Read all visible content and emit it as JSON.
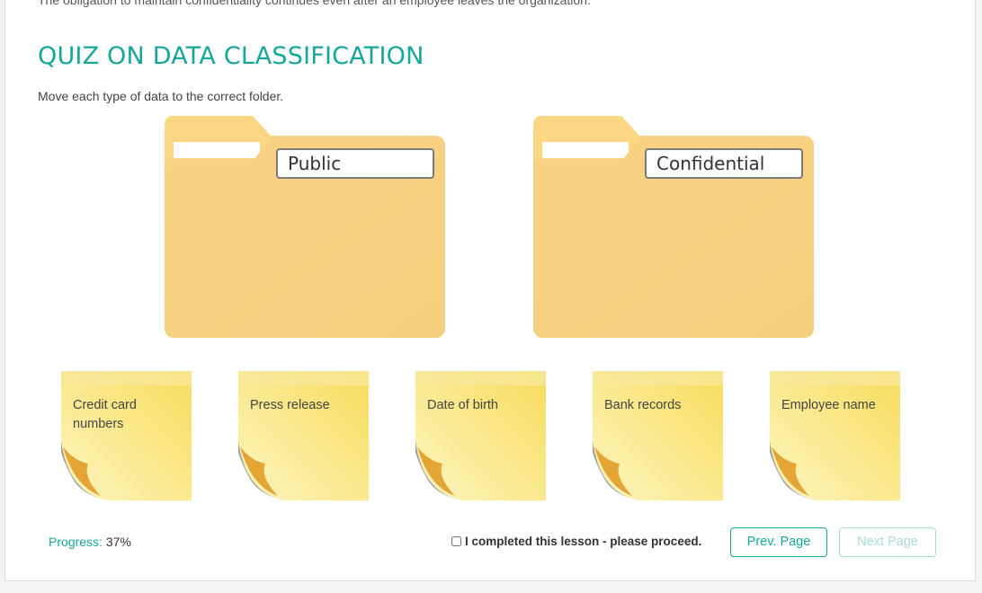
{
  "intro_text": "The obligation to maintain confidentiality continues even after an employee leaves the organization.",
  "quiz": {
    "title": "QUIZ ON DATA CLASSIFICATION",
    "instructions": "Move each type of data to the correct folder.",
    "folders": [
      {
        "label": "Public"
      },
      {
        "label": "Confidential"
      }
    ],
    "notes": [
      {
        "label": "Credit card numbers"
      },
      {
        "label": "Press release"
      },
      {
        "label": "Date of birth"
      },
      {
        "label": "Bank records"
      },
      {
        "label": "Employee name"
      }
    ]
  },
  "footer": {
    "progress_label": "Progress:",
    "progress_value": "37%",
    "complete_label": "I completed this lesson - please proceed.",
    "complete_checked": false,
    "prev_label": "Prev. Page",
    "next_label": "Next Page"
  },
  "colors": {
    "accent": "#15a89a",
    "folder": "#f7d07f",
    "note": "#f9e27a"
  },
  "icons": {
    "folder": "folder-icon",
    "note": "sticky-note-icon"
  }
}
